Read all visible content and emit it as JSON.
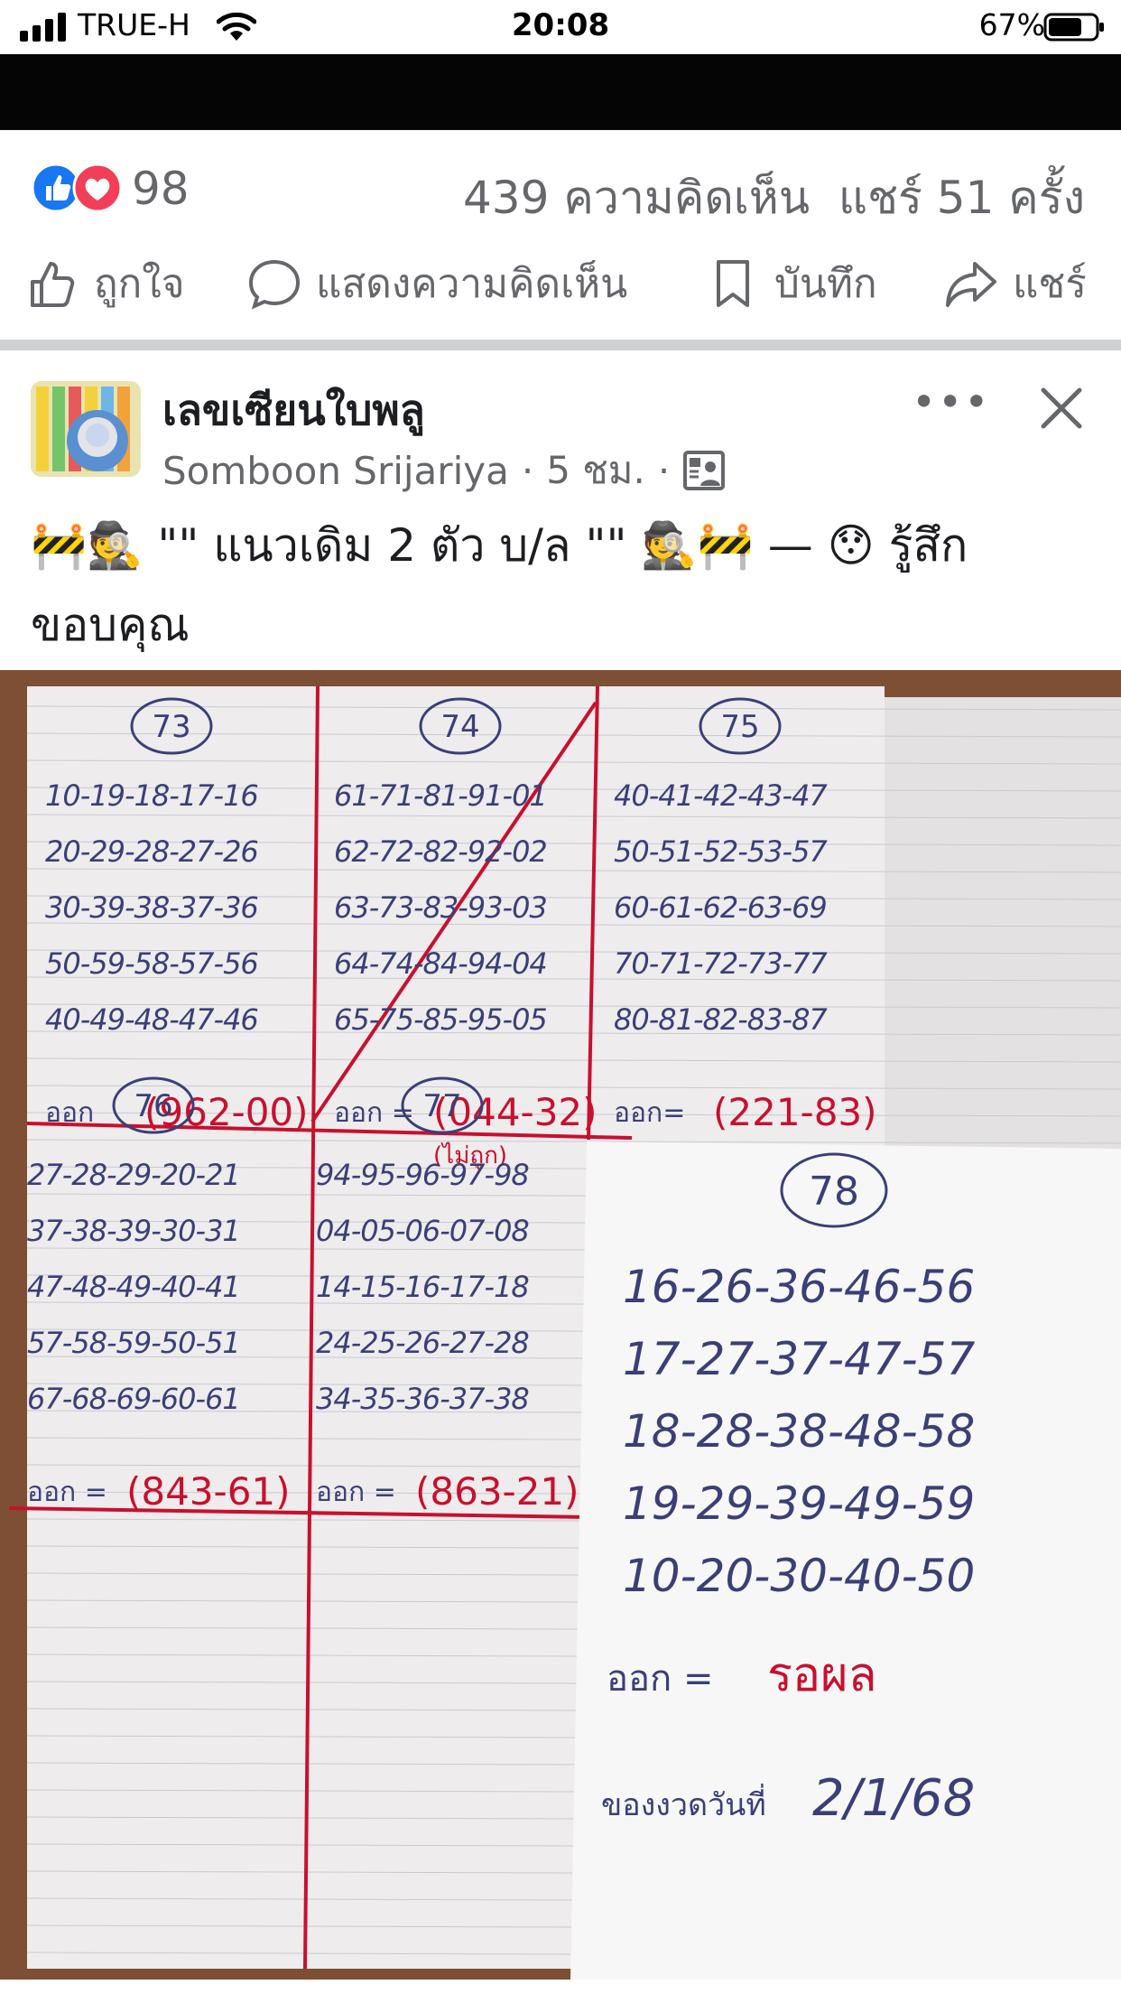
{
  "status_bar": {
    "carrier": "TRUE-H",
    "time": "20:08",
    "battery": "67%"
  },
  "reactions": {
    "count": "98",
    "comments": "439 ความคิดเห็น",
    "shares": "แชร์ 51 ครั้ง"
  },
  "actions": {
    "like": "ถูกใจ",
    "comment": "แสดงความคิดเห็น",
    "save": "บันทึก",
    "share": "แชร์"
  },
  "post": {
    "page_name": "เลขเซียนใบพลู",
    "author": "Somboon Srijariya",
    "time": "5 ชม.",
    "text": "🚧🕵️ \"\" แนวเดิม 2 ตัว บ/ล \"\" 🕵️🚧 — 😯 รู้สึกขอบคุณ"
  },
  "photo": {
    "blocks": [
      {
        "label": "73",
        "rows": [
          "10-19-18-17-16",
          "20-29-28-27-26",
          "30-39-38-37-36",
          "50-59-58-57-56",
          "40-49-48-47-46"
        ],
        "result": "962-00",
        "result_prefix": "ออก"
      },
      {
        "label": "74",
        "rows": [
          "61-71-81-91-01",
          "62-72-82-92-02",
          "63-73-83-93-03",
          "64-74-84-94-04",
          "65-75-85-95-05"
        ],
        "result": "044-32",
        "result_prefix": "ออก =",
        "note": "ไม่ถูก"
      },
      {
        "label": "75",
        "rows": [
          "40-41-42-43-47",
          "50-51-52-53-57",
          "60-61-62-63-69",
          "70-71-72-73-77",
          "80-81-82-83-87"
        ],
        "result": "221-83",
        "result_prefix": "ออก="
      },
      {
        "label": "76",
        "rows": [
          "27-28-29-20-21",
          "37-38-39-30-31",
          "47-48-49-40-41",
          "57-58-59-50-51",
          "67-68-69-60-61"
        ],
        "result": "843-61",
        "result_prefix": "ออก ="
      },
      {
        "label": "77",
        "rows": [
          "94-95-96-97-98",
          "04-05-06-07-08",
          "14-15-16-17-18",
          "24-25-26-27-28",
          "34-35-36-37-38"
        ],
        "result": "863-21",
        "result_prefix": "ออก ="
      }
    ],
    "card": {
      "label": "78",
      "rows": [
        "16-26-36-46-56",
        "17-27-37-47-57",
        "18-28-38-48-58",
        "19-29-39-49-59",
        "10-20-30-40-50"
      ],
      "result_prefix": "ออก =",
      "result": "รอผล",
      "date_label": "ของงวดวันที่",
      "date": "2/1/68"
    }
  },
  "colors": {
    "brand_blue": "#1877f2",
    "love_red": "#f33e58",
    "ink_red": "#c8102e",
    "ink_blue": "#3a3f78"
  }
}
